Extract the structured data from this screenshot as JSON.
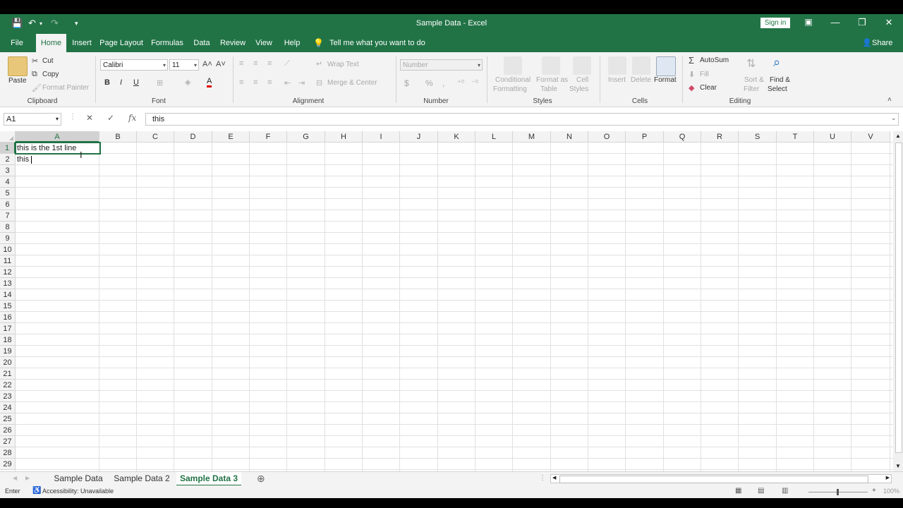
{
  "window": {
    "title": "Sample Data  -  Excel",
    "sign_in": "Sign in"
  },
  "tabs": [
    "File",
    "Home",
    "Insert",
    "Page Layout",
    "Formulas",
    "Data",
    "Review",
    "View",
    "Help"
  ],
  "tell_me": "Tell me what you want to do",
  "share": "Share",
  "ribbon": {
    "clipboard": {
      "paste": "Paste",
      "cut": "Cut",
      "copy": "Copy",
      "format_painter": "Format Painter",
      "label": "Clipboard"
    },
    "font": {
      "name": "Calibri",
      "size": "11",
      "bold": "B",
      "italic": "I",
      "underline": "U",
      "label": "Font"
    },
    "alignment": {
      "wrap_text": "Wrap Text",
      "merge_center": "Merge & Center",
      "label": "Alignment"
    },
    "number": {
      "format": "Number",
      "currency": "$",
      "percent": "%",
      "comma": ",",
      "label": "Number"
    },
    "styles": {
      "conditional": "Conditional",
      "formatting": "Formatting",
      "format_as": "Format as",
      "table": "Table",
      "cell": "Cell",
      "styles_word": "Styles",
      "label": "Styles"
    },
    "cells": {
      "insert": "Insert",
      "delete": "Delete",
      "format": "Format",
      "label": "Cells"
    },
    "editing": {
      "autosum": "AutoSum",
      "fill": "Fill",
      "clear": "Clear",
      "sort": "Sort &",
      "filter": "Filter",
      "find": "Find &",
      "select": "Select",
      "label": "Editing"
    }
  },
  "formula_bar": {
    "name_box": "A1",
    "cancel": "✕",
    "enter": "✓",
    "fx": "fx",
    "value": "this"
  },
  "columns": [
    "A",
    "B",
    "C",
    "D",
    "E",
    "F",
    "G",
    "H",
    "I",
    "J",
    "K",
    "L",
    "M",
    "N",
    "O",
    "P",
    "Q",
    "R",
    "S",
    "T",
    "U",
    "V"
  ],
  "rows": [
    "1",
    "2",
    "3",
    "4",
    "5",
    "6",
    "7",
    "8",
    "9",
    "10",
    "11",
    "12",
    "13",
    "14",
    "15",
    "16",
    "17",
    "18",
    "19",
    "20",
    "21",
    "22",
    "23",
    "24",
    "25",
    "26",
    "27",
    "28",
    "29"
  ],
  "cells": {
    "A1": "this is the 1st line",
    "A2": "this"
  },
  "sheets": [
    "Sample Data",
    "Sample Data 2",
    "Sample Data 3"
  ],
  "active_sheet": "Sample Data 3",
  "status": {
    "mode": "Enter",
    "accessibility": "Accessibility: Unavailable",
    "zoom": "100%"
  },
  "colors": {
    "brand": "#217346",
    "ribbon_bg": "#f3f3f3",
    "grid_line": "#e1e1e1"
  },
  "icons": [
    "save-icon",
    "undo-icon",
    "redo-icon",
    "customize-icon",
    "lightbulb-icon",
    "person-icon",
    "paste-icon",
    "cut-icon",
    "copy-icon",
    "format-painter-icon",
    "font-color-icon",
    "fill-color-icon",
    "borders-icon",
    "autosum-icon",
    "fill-icon",
    "eraser-icon",
    "sort-filter-icon",
    "find-icon",
    "ribbon-display-icon",
    "minimize-icon",
    "restore-icon",
    "close-icon",
    "new-sheet-icon"
  ]
}
